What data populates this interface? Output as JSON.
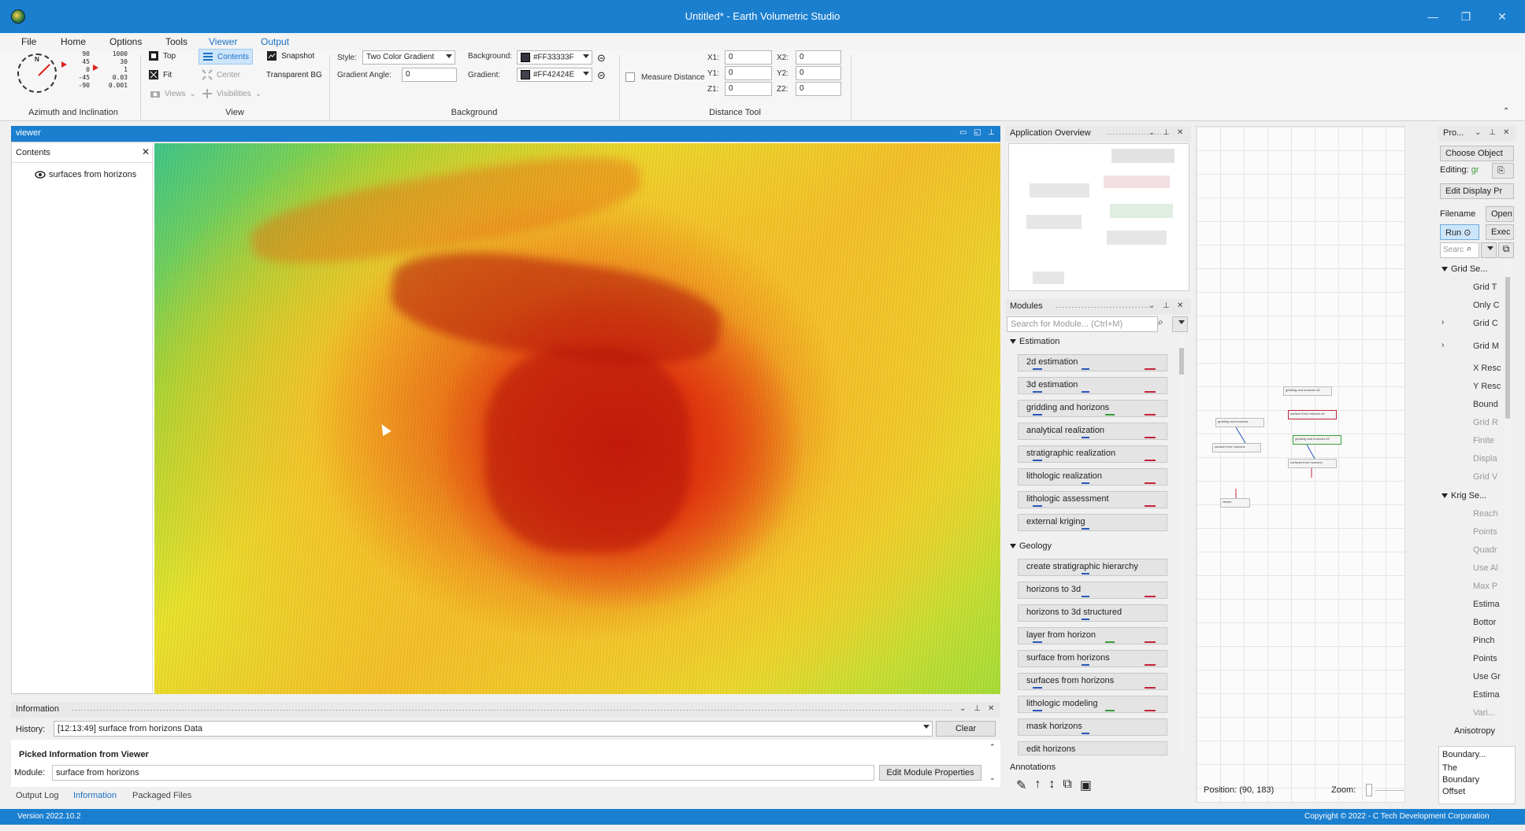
{
  "window": {
    "title": "Untitled* - Earth Volumetric Studio"
  },
  "menu": {
    "items": [
      "File",
      "Home",
      "Options",
      "Tools",
      "Viewer",
      "Output"
    ]
  },
  "ribbon": {
    "azimuth": {
      "label": "Azimuth and Inclination",
      "inclination_values": [
        "90",
        "45",
        "0",
        "-45",
        "-90"
      ],
      "scale_values": [
        "1000",
        "30",
        "1",
        "0.03",
        "0.001"
      ]
    },
    "view": {
      "label": "View",
      "top": "Top",
      "contents": "Contents",
      "snapshot": "Snapshot",
      "fit": "Fit",
      "center": "Center",
      "transparent_bg": "Transparent BG",
      "views": "Views",
      "visibilities": "Visibilities"
    },
    "background": {
      "label": "Background",
      "style_label": "Style:",
      "style_value": "Two Color Gradient",
      "angle_label": "Gradient Angle:",
      "angle_value": "0",
      "bg_label": "Background:",
      "bg_value": "#FF33333F",
      "bg_color": "#33333F",
      "grad_label": "Gradient:",
      "grad_value": "#FF42424E",
      "grad_color": "#42424E"
    },
    "distance": {
      "label": "Distance Tool",
      "measure": "Measure Distance",
      "x1_label": "X1:",
      "x1": "0",
      "y1_label": "Y1:",
      "y1": "0",
      "z1_label": "Z1:",
      "z1": "0",
      "x2_label": "X2:",
      "x2": "0",
      "y2_label": "Y2:",
      "y2": "0",
      "z2_label": "Z2:",
      "z2": "0"
    }
  },
  "viewer": {
    "title": "viewer",
    "contents_title": "Contents",
    "tree_item": "surfaces from horizons"
  },
  "overview": {
    "title": "Application Overview"
  },
  "modules": {
    "title": "Modules",
    "search_placeholder": "Search for Module... (Ctrl+M)",
    "estimation_label": "Estimation",
    "estimation": [
      "2d estimation",
      "3d estimation",
      "gridding and horizons",
      "analytical realization",
      "stratigraphic realization",
      "lithologic realization",
      "lithologic assessment",
      "external kriging"
    ],
    "geology_label": "Geology",
    "geology": [
      "create stratigraphic hierarchy",
      "horizons to 3d",
      "horizons to 3d structured",
      "layer from horizon",
      "surface from horizons",
      "surfaces from horizons",
      "lithologic modeling",
      "mask horizons",
      "edit horizons"
    ],
    "annotations_label": "Annotations"
  },
  "network": {
    "position": "Position: (90, 183)",
    "zoom": "Zoom:",
    "nodes": [
      "gridding and horizons #1",
      "surface from horizons #1",
      "gridding and horizons",
      "surface from horizons",
      "gridding and horizons #2",
      "surfaces from horizons",
      "viewer"
    ]
  },
  "properties": {
    "title": "Pro...",
    "choose_object": "Choose Object",
    "editing_label": "Editing:",
    "editing_value": "gr",
    "edit_display": "Edit Display Pr",
    "filename": "Filename",
    "open": "Open",
    "run": "Run",
    "exec": "Exec",
    "search": "Searc",
    "grid_section": "Grid Se...",
    "grid_items": [
      "Grid T",
      "Only C",
      "Grid C",
      "Grid M",
      "X Resc",
      "Y Resc",
      "Bound",
      "Grid R",
      "Finite",
      "Displa",
      "Grid V"
    ],
    "krig_section": "Krig Se...",
    "krig_items": [
      "Reach",
      "Points",
      "Quadr",
      "Use Al",
      "Max P",
      "Estima",
      "Bottor",
      "Pinch",
      "Points",
      "Use Gr",
      "Estima",
      "Vari...",
      "Anisotropy"
    ],
    "boundary_title": "Boundary...",
    "boundary_text": [
      "The",
      "Boundary",
      "Offset"
    ]
  },
  "information": {
    "title": "Information",
    "history_label": "History:",
    "history_value": "[12:13:49] surface from horizons Data",
    "clear": "Clear",
    "picked": "Picked Information from Viewer",
    "module_label": "Module:",
    "module_value": "surface from horizons",
    "edit_props": "Edit Module Properties",
    "tabs": [
      "Output Log",
      "Information",
      "Packaged Files"
    ]
  },
  "status": {
    "version": "Version 2022.10.2",
    "copyright": "Copyright © 2022 - C Tech Development Corporation"
  }
}
